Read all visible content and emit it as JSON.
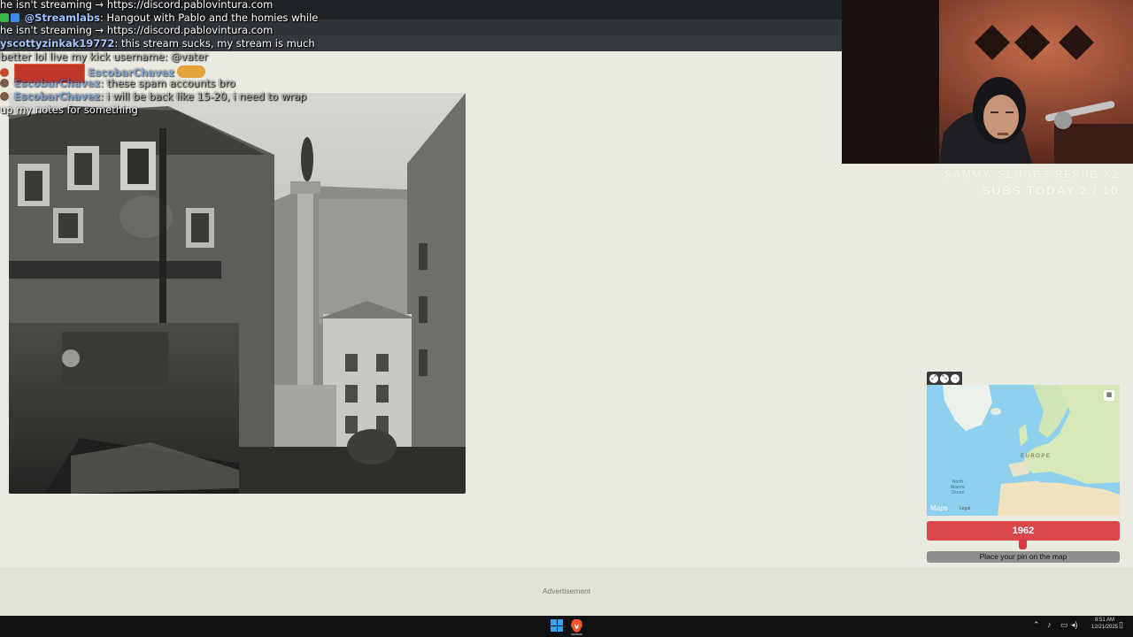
{
  "chat": {
    "lines": [
      {
        "text": "he isn't streaming → https://discord.pablovintura.com"
      },
      {
        "user": "@Streamlabs",
        "text": ": Hangout with Pablo and the homies while"
      },
      {
        "text": "he isn't streaming → https://discord.pablovintura.com"
      },
      {
        "user": "yscottyzinkak19772",
        "text": ": this stream sucks, my stream is much"
      },
      {
        "text": "better lol live my kick username: @vater"
      },
      {
        "user": "EscobarChavez",
        "text": ""
      },
      {
        "user": "EscobarChavez",
        "text": ": these spam accounts bro"
      },
      {
        "user": "EscobarChavez",
        "text": ": i will be back like 15-20, i need to wrap"
      },
      {
        "text": "up my notes for something"
      }
    ]
  },
  "overlay": {
    "sub_goal_name": "SAMMY_SLUGGS RESUB X2",
    "sub_goal_count": "SUBS TODAY 2 / 10"
  },
  "map": {
    "provider": "Maps",
    "legal": "Legal",
    "region_label": "EUROPE",
    "ocean_label": "North Atlantic Ocean"
  },
  "game": {
    "year": "1962",
    "guess_prompt": "Place your pin on the map"
  },
  "ad": {
    "label": "Advertisement"
  },
  "taskbar": {
    "time": "8:51 AM",
    "date": "12/21/2025"
  },
  "colors": {
    "page_bg": "#ebeae0",
    "year_bar": "#d8474a",
    "map_water": "#8fd0ee"
  }
}
